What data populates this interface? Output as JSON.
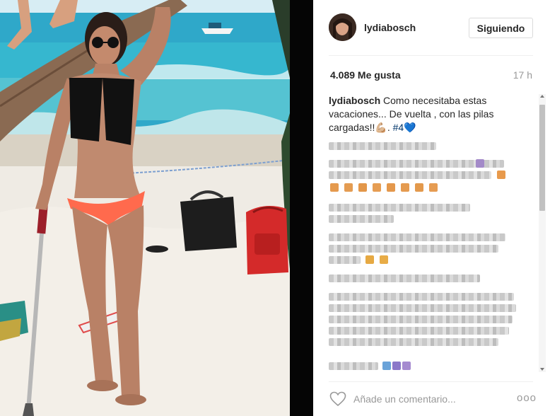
{
  "post": {
    "username": "lydiabosch",
    "follow_label": "Siguiendo",
    "likes": "4.089 Me gusta",
    "time_ago": "17 h",
    "caption": {
      "username": "lydiabosch",
      "text": "Como necesitaba estas vacaciones... De vuelta , con las pilas cargadas!!",
      "emoji_flex": "💪🏼",
      "after_emoji": ". ",
      "hashtag": "#4",
      "emoji_heart": "💙"
    },
    "comment_placeholder": "Añade un comentario...",
    "more_label": "ooo"
  },
  "colors": {
    "sky": "#cfe8f2",
    "sea": "#2fa6c7",
    "sand": "#eee9e0",
    "bikini_top": "#111111",
    "bikini_bottom": "#ff6a4d",
    "backpack": "#d62a2a",
    "panel_text": "#262626",
    "muted": "#999999"
  },
  "icons": [
    "heart-icon",
    "more-options-icon",
    "scroll-up-icon",
    "scroll-down-icon"
  ]
}
